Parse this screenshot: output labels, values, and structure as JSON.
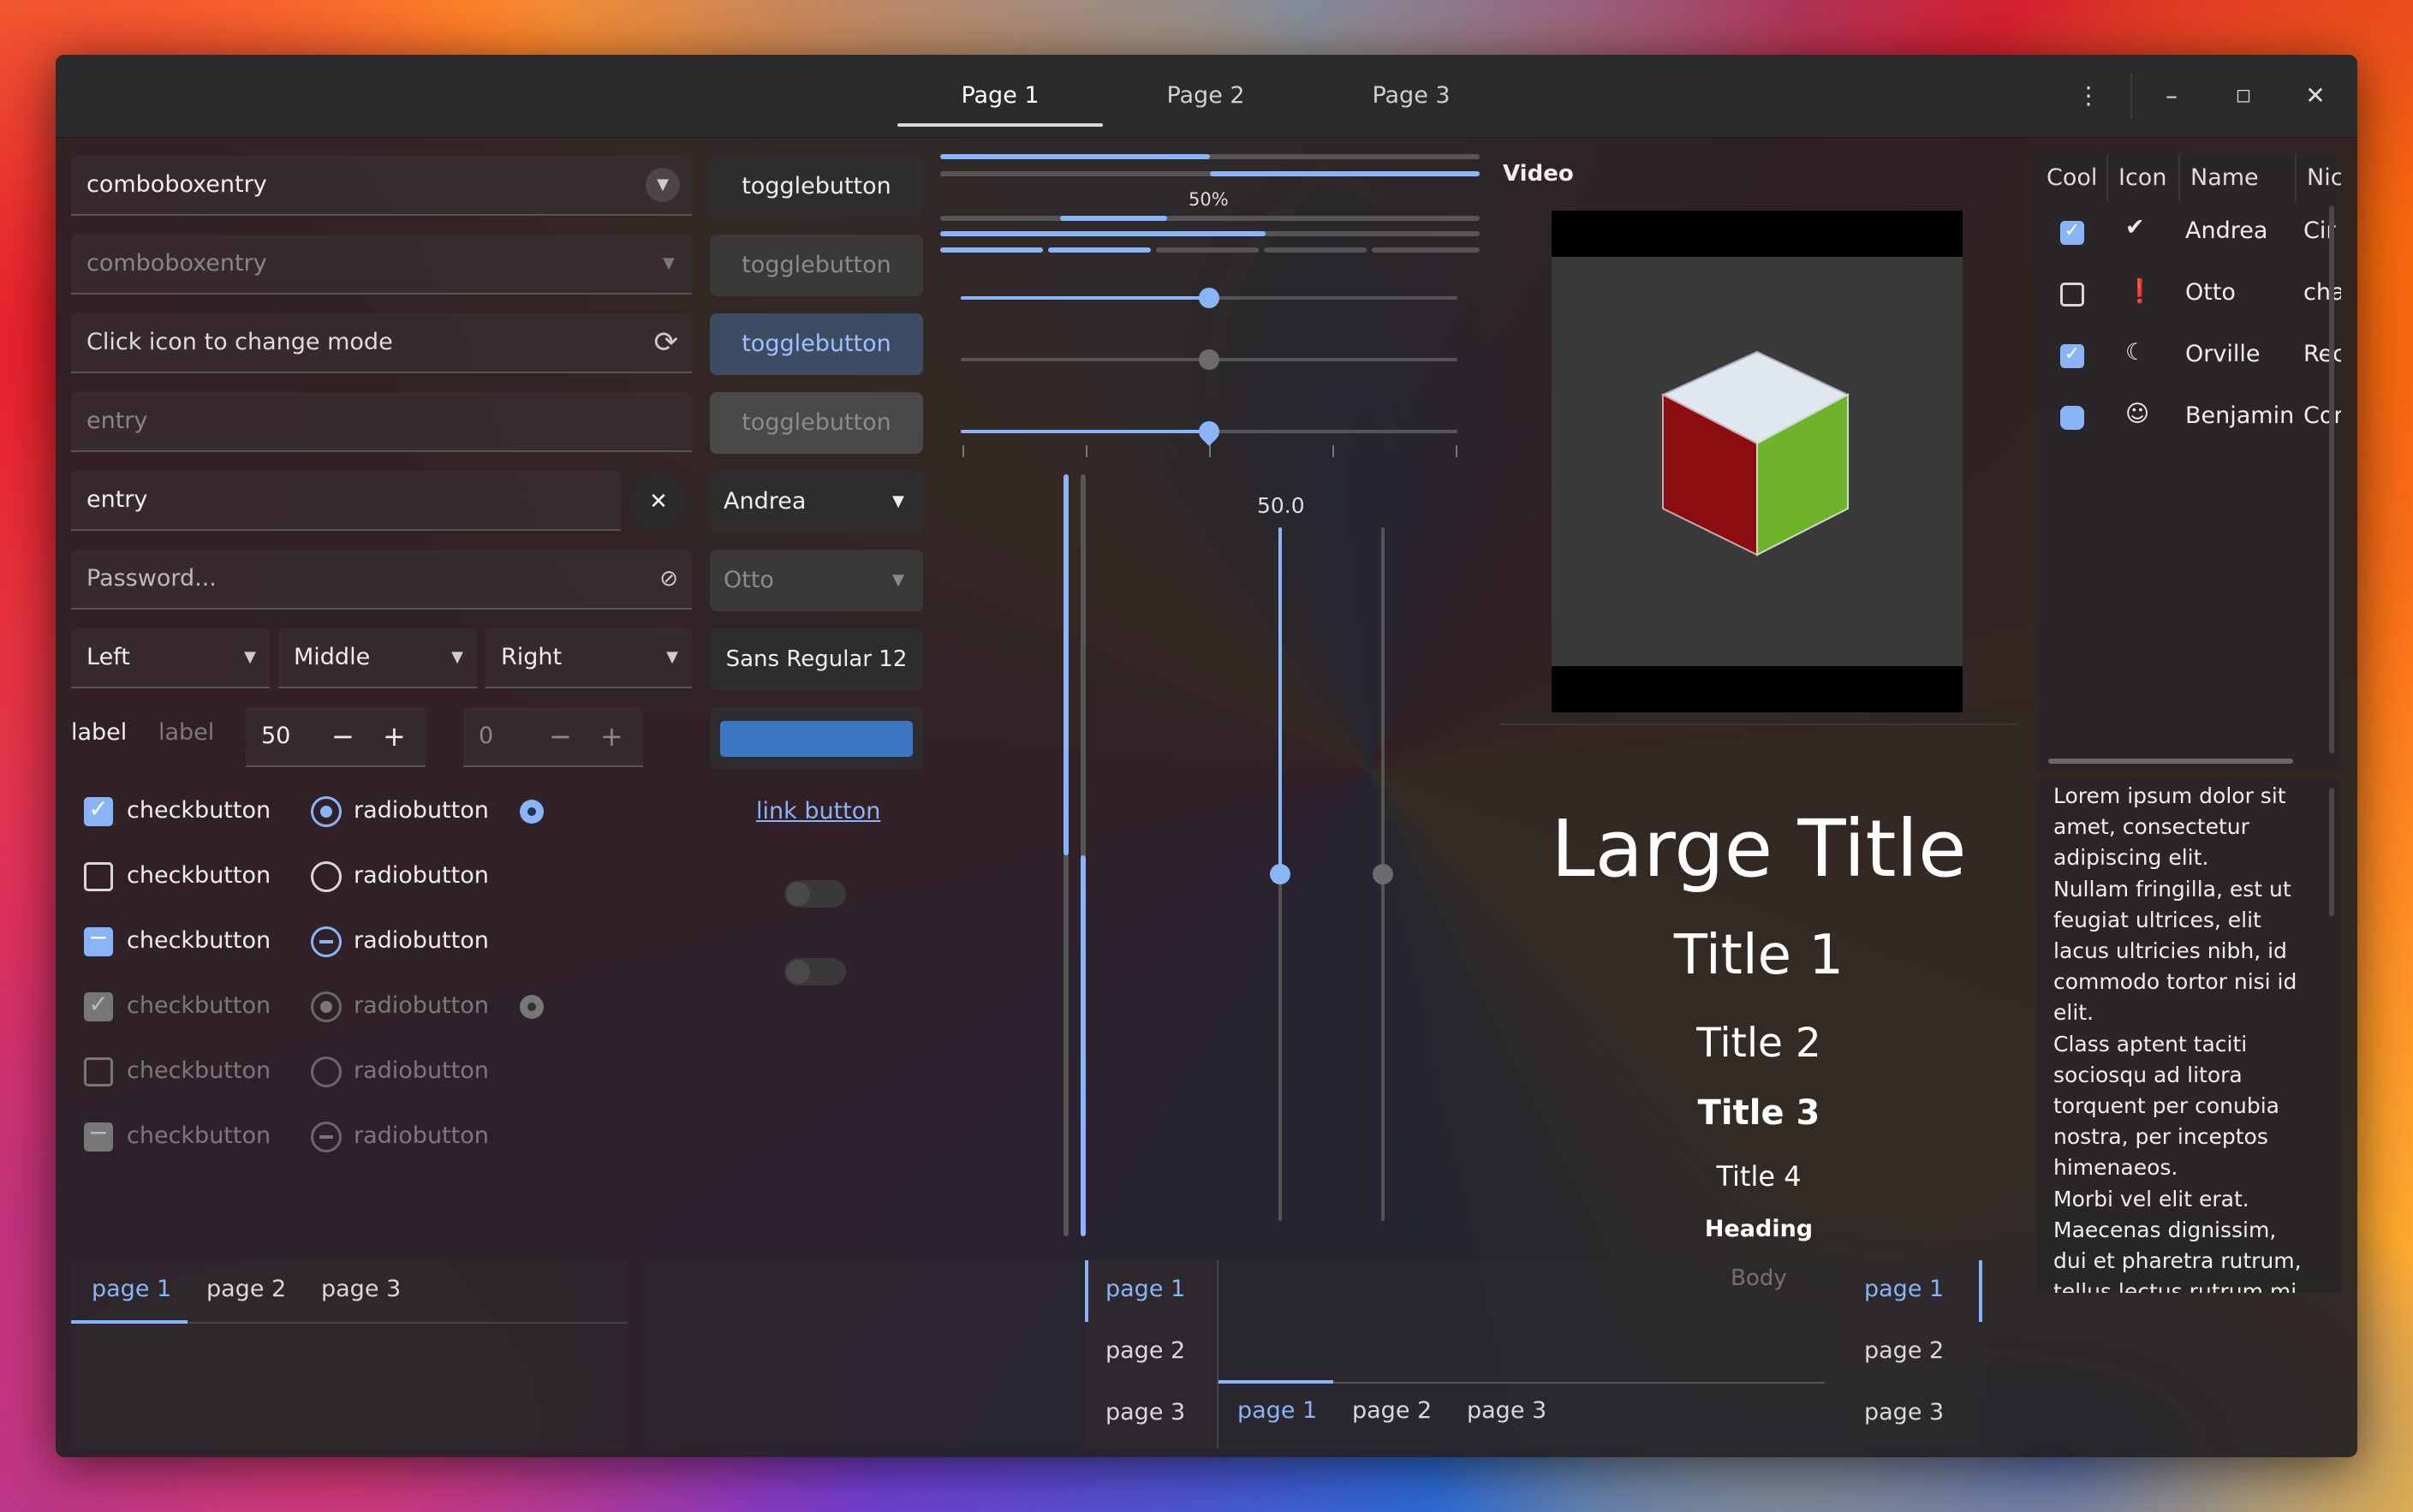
{
  "header": {
    "tabs": [
      "Page 1",
      "Page 2",
      "Page 3"
    ],
    "menu_icon": "vertical-dots-icon",
    "minimize_icon": "minimize-icon",
    "maximize_icon": "maximize-icon",
    "close_icon": "close-icon"
  },
  "entries": {
    "combo1": "comboboxentry",
    "combo2": "comboboxentry",
    "mode_placeholder": "Click icon to change mode",
    "entry_disabled": "entry",
    "entry": "entry",
    "password_placeholder": "Password..."
  },
  "dropdowns": {
    "left": "Left",
    "middle": "Middle",
    "right": "Right"
  },
  "spin": {
    "label1": "label",
    "label2": "label",
    "value1": "50",
    "value2": "0"
  },
  "checks": [
    {
      "label": "checkbutton",
      "radio": "radiobutton"
    },
    {
      "label": "checkbutton",
      "radio": "radiobutton"
    },
    {
      "label": "checkbutton",
      "radio": "radiobutton"
    },
    {
      "label": "checkbutton",
      "radio": "radiobutton"
    },
    {
      "label": "checkbutton",
      "radio": "radiobutton"
    },
    {
      "label": "checkbutton",
      "radio": "radiobutton"
    }
  ],
  "buttons": {
    "toggle": [
      "togglebutton",
      "togglebutton",
      "togglebutton",
      "togglebutton"
    ],
    "combo_andrea": "Andrea",
    "combo_otto": "Otto",
    "font": "Sans Regular  12",
    "link": "link button"
  },
  "progress": {
    "label": "50%",
    "fraction": 0.5
  },
  "scale": {
    "vertical_value": "50.0",
    "value": 50
  },
  "video": {
    "title": "Video"
  },
  "typography": {
    "large_title": "Large Title",
    "title1": "Title 1",
    "title2": "Title 2",
    "title3": "Title 3",
    "title4": "Title 4",
    "heading": "Heading",
    "body": "Body"
  },
  "tree": {
    "headers": [
      "Cool",
      "Icon",
      "Name",
      "Nic"
    ],
    "rows": [
      {
        "name": "Andrea",
        "nick": "Cir",
        "icon": "check-circle-icon",
        "cool": true
      },
      {
        "name": "Otto",
        "nick": "cha",
        "icon": "warning-icon",
        "cool": false
      },
      {
        "name": "Orville",
        "nick": "Rec",
        "icon": "moon-icon",
        "cool": true
      },
      {
        "name": "Benjamin",
        "nick": "Cor",
        "icon": "face-icon",
        "cool": "mixed"
      }
    ]
  },
  "text_view": [
    "Lorem ipsum dolor sit",
    "amet, consectetur",
    "adipiscing elit.",
    "Nullam fringilla, est ut",
    "feugiat ultrices, elit",
    "lacus ultricies nibh, id",
    "commodo tortor nisi id",
    "elit.",
    "Class aptent taciti",
    "sociosqu ad litora",
    "torquent per conubia",
    "nostra, per inceptos",
    "himenaeos.",
    "Morbi vel elit erat.",
    "Maecenas dignissim,",
    "dui et pharetra rutrum,",
    "tellus lectus rutrum mi"
  ],
  "notebooks": {
    "bottom_left": [
      "page 1",
      "page 2",
      "page 3"
    ],
    "left_side": [
      "page 1",
      "page 2",
      "page 3"
    ],
    "bottom_mid": [
      "page 1",
      "page 2",
      "page 3"
    ],
    "right_side": [
      "page 1",
      "page 2",
      "page 3"
    ]
  },
  "colors": {
    "accent": "#8ab4f8",
    "window_bg": "#232024",
    "header_bg": "#2b2a2d"
  }
}
